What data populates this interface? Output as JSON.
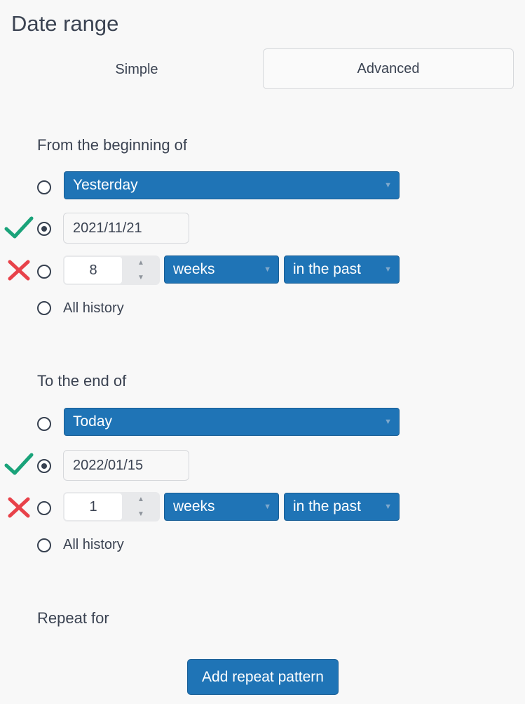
{
  "title": "Date range",
  "tabs": {
    "simple": "Simple",
    "advanced": "Advanced"
  },
  "from": {
    "label": "From the beginning of",
    "preset": "Yesterday",
    "date": "2021/11/21",
    "count": "8",
    "unit": "weeks",
    "direction": "in the past",
    "all_history": "All history"
  },
  "to": {
    "label": "To the end of",
    "preset": "Today",
    "date": "2022/01/15",
    "count": "1",
    "unit": "weeks",
    "direction": "in the past",
    "all_history": "All history"
  },
  "repeat": {
    "label": "Repeat for",
    "button": "Add repeat pattern"
  },
  "icons": {
    "check": "check-icon",
    "cross": "cross-icon",
    "dropdown": "caret-down-icon",
    "spin_up": "caret-up-icon",
    "spin_down": "caret-down-icon"
  },
  "colors": {
    "accent": "#1f74b6",
    "check": "#1aa37a",
    "cross": "#e8424a",
    "text": "#3b4352"
  }
}
